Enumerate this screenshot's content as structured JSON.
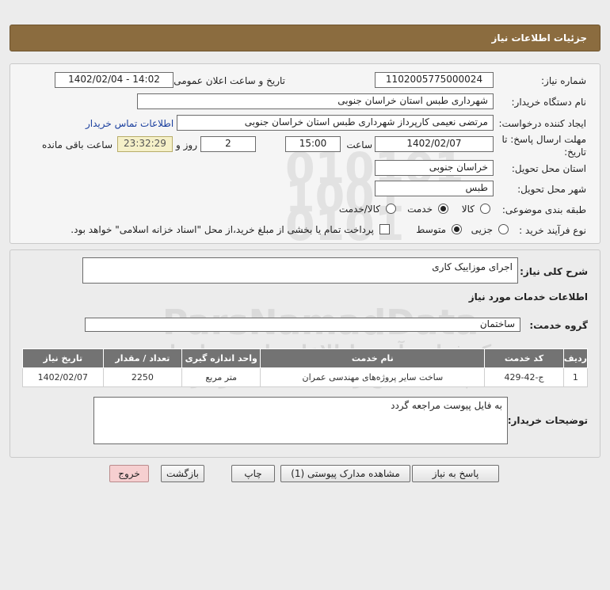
{
  "page_title": "جزئیات اطلاعات نیاز",
  "info": {
    "need_number_label": "شماره نیاز:",
    "need_number": "1102005775000024",
    "announce_label": "تاریخ و ساعت اعلان عمومی:",
    "announce_value": "1402/02/04 - 14:02",
    "buyer_label": "نام دستگاه خریدار:",
    "buyer_value": "شهرداری طبس استان خراسان جنوبی",
    "creator_label": "ایجاد کننده درخواست:",
    "creator_value": "مرتضی نعیمی کارپرداز شهرداری طبس استان خراسان جنوبی",
    "contact_link": "اطلاعات تماس خریدار",
    "deadline_label_1": "مهلت ارسال پاسخ: تا",
    "deadline_label_2": "تاریخ:",
    "deadline_date": "1402/02/07",
    "time_label": "ساعت",
    "deadline_time": "15:00",
    "days_value": "2",
    "days_label": "روز و",
    "remaining_time": "23:32:29",
    "remaining_label": "ساعت باقی مانده",
    "province_label": "استان محل تحویل:",
    "province_value": "خراسان جنوبی",
    "city_label": "شهر محل تحویل:",
    "city_value": "طبس",
    "category_label": "طبقه بندی موضوعی:",
    "category_options": [
      "کالا",
      "خدمت",
      "کالا/خدمت"
    ],
    "category_selected": "خدمت",
    "process_label": "نوع فرآیند خرید :",
    "process_options": [
      "جزیی",
      "متوسط"
    ],
    "process_selected": "متوسط",
    "payment_note": "پرداخت تمام یا بخشی از مبلغ خرید،از محل \"اسناد خزانه اسلامی\" خواهد بود."
  },
  "need_desc_label": "شرح کلی نیاز:",
  "need_desc": "اجرای موزاییک کاری",
  "services_heading": "اطلاعات خدمات مورد نیاز",
  "service_group_label": "گروه خدمت:",
  "service_group": "ساختمان",
  "table": {
    "headers": [
      "ردیف",
      "کد خدمت",
      "نام خدمت",
      "واحد اندازه گیری",
      "تعداد / مقدار",
      "تاریخ نیاز"
    ],
    "rows": [
      [
        "1",
        "ج-42-429",
        "ساخت سایر پروژه‌های مهندسی عمران",
        "متر مربع",
        "2250",
        "1402/02/07"
      ]
    ]
  },
  "buyer_notes_label": "توضیحات خریدار:",
  "buyer_notes": "به فایل پیوست مراجعه گردد",
  "buttons": {
    "reply": "پاسخ به نیاز",
    "attachments": "مشاهده مدارک پیوستی (1)",
    "print": "چاپ",
    "back": "بازگشت",
    "exit": "خروج"
  },
  "watermark": {
    "brand": "ParsNamadData",
    "line1": "مرکز فراهم آوری اطلاعات پارس نماد داده",
    "line2": "پایگاه اطلاع رسانی مناقصه و مزایده",
    "phone": "۰۲۱-۸۸۳۴۹۶۷۰-۵"
  },
  "colors": {
    "title_bar": "#8b6c3f",
    "table_header": "#737373",
    "link": "#1a3f9e",
    "remaining_bg": "#f5f0c8",
    "exit_bg": "#f6cfd0"
  }
}
